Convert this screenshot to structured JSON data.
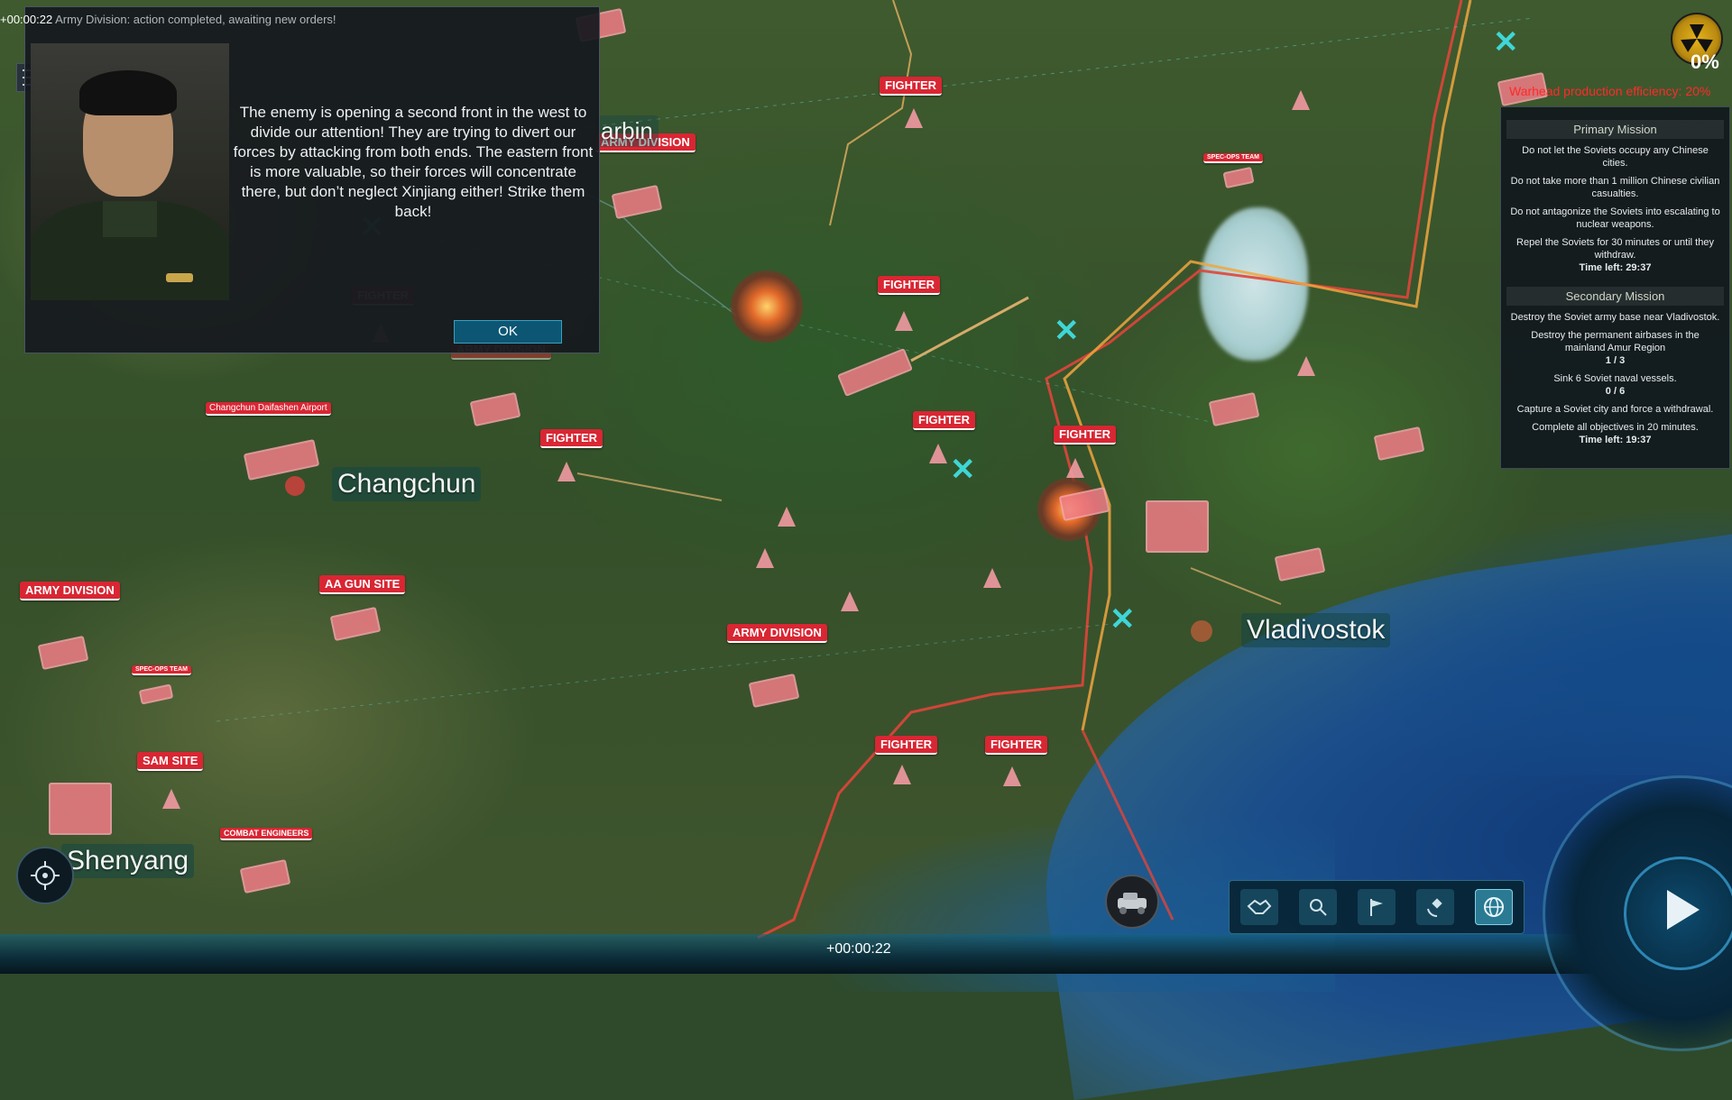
{
  "log": {
    "time": "+00:00:22",
    "message": "Army Division: action completed, awaiting new orders!"
  },
  "dialog": {
    "text": "The enemy is opening a second front in the west to divide our attention! They are trying to divert our forces by attacking from both ends. The eastern front is more valuable, so their forces will concentrate there, but don’t neglect Xinjiang either! Strike them back!",
    "ok_label": "OK",
    "portrait": "general-portrait"
  },
  "status": {
    "nuke_percent": "0%",
    "warhead_text": "Warhead production efficiency: 20%"
  },
  "missions": {
    "primary_title": "Primary Mission",
    "primary": [
      "Do not let the Soviets occupy any Chinese cities.",
      "Do not take more than 1 million Chinese civilian casualties.",
      "Do not antagonize the Soviets into escalating to nuclear weapons.",
      "Repel the Soviets for 30 minutes or until they withdraw."
    ],
    "primary_time": "Time left: 29:37",
    "secondary_title": "Secondary Mission",
    "secondary": [
      {
        "text": "Destroy the Soviet army base near Vladivostok.",
        "count": ""
      },
      {
        "text": "Destroy the permanent airbases in the mainland Amur Region",
        "count": "1 / 3"
      },
      {
        "text": "Sink 6 Soviet naval vessels.",
        "count": "0 / 6"
      },
      {
        "text": "Capture a Soviet city and force a withdrawal.",
        "count": ""
      },
      {
        "text": "Complete all objectives in 20 minutes.",
        "count": ""
      }
    ],
    "secondary_time": "Time left: 19:37"
  },
  "cities": {
    "changchun": "Changchun",
    "vladivostok": "Vladivostok",
    "shenyang": "Shenyang",
    "harbin_partial": "arbin"
  },
  "unit_labels": {
    "fighter": "FIGHTER",
    "army_division": "ARMY DIVISION",
    "aa_gun_site": "AA GUN SITE",
    "sam_site": "SAM SITE",
    "combat_engineers": "COMBAT ENGINEERS",
    "spec_ops": "SPEC-OPS TEAM",
    "airport": "Changchun Daifashen Airport"
  },
  "bottom": {
    "timer": "+00:00:22"
  },
  "toolbar": {
    "tools": [
      "diplomacy-icon",
      "search-icon",
      "flag-icon",
      "satellite-icon",
      "globe-icon"
    ],
    "active": "globe-icon"
  },
  "colors": {
    "enemy": "#d92633",
    "ally_border": "#f0a640",
    "front_line": "#e0453a",
    "accent": "#3fd6d6"
  }
}
